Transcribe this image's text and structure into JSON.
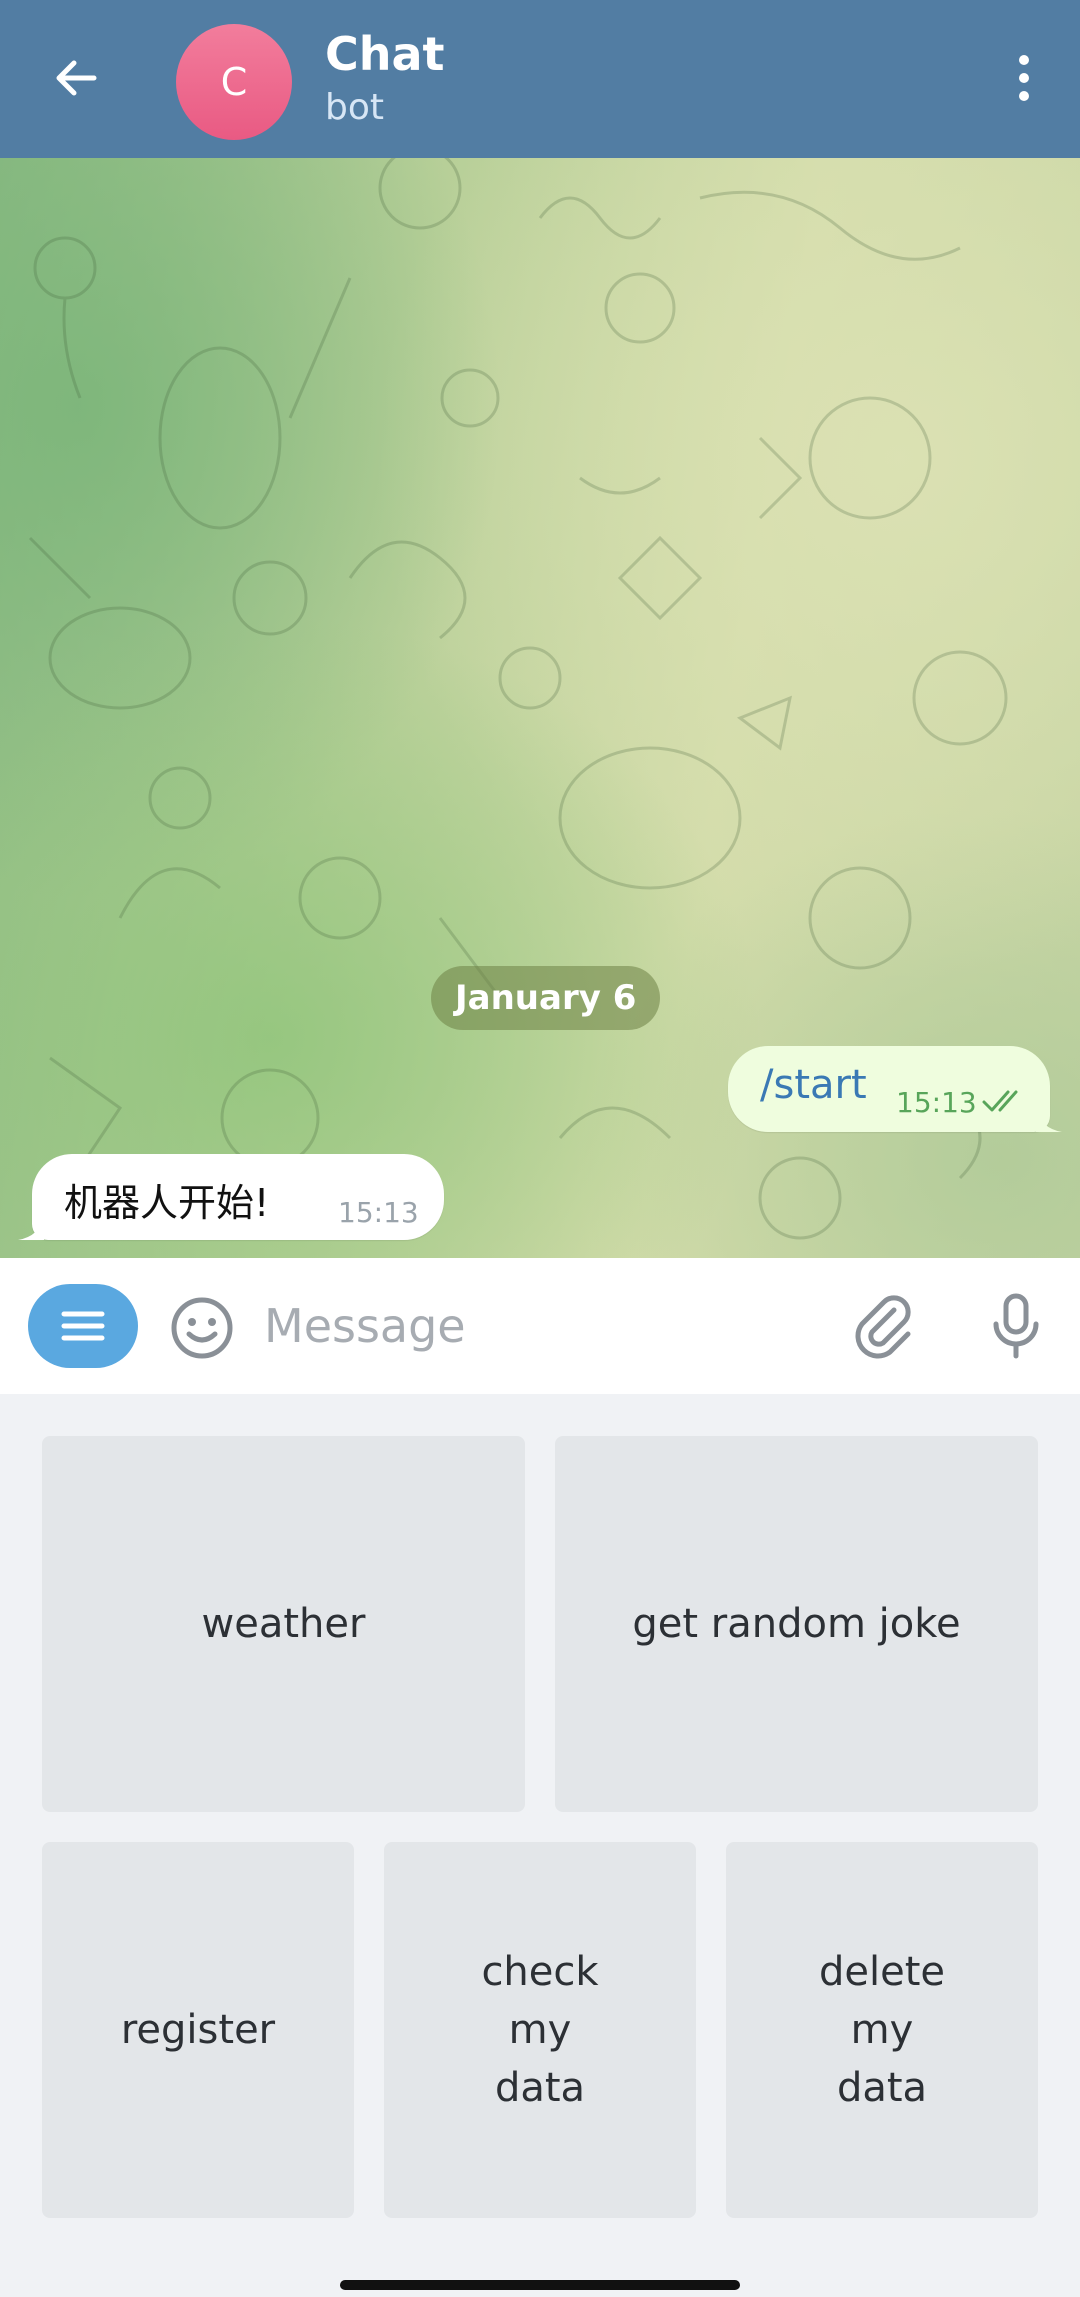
{
  "header": {
    "avatar_initial": "C",
    "title": "Chat",
    "subtitle": "bot",
    "colors": {
      "bar": "#527da3",
      "avatar": "#ec6a8d"
    }
  },
  "chat": {
    "date_label": "January 6",
    "messages": [
      {
        "direction": "outgoing",
        "text": "/start",
        "time": "15:13",
        "status": "read"
      },
      {
        "direction": "incoming",
        "text": "机器人开始!",
        "time": "15:13"
      }
    ]
  },
  "input": {
    "placeholder": "Message",
    "icons": [
      "bot-menu-icon",
      "emoji-icon",
      "attach-icon",
      "mic-icon"
    ]
  },
  "keyboard": {
    "rows": [
      [
        "weather",
        "get random joke"
      ],
      [
        "register",
        "check my data",
        "delete my data"
      ]
    ]
  }
}
